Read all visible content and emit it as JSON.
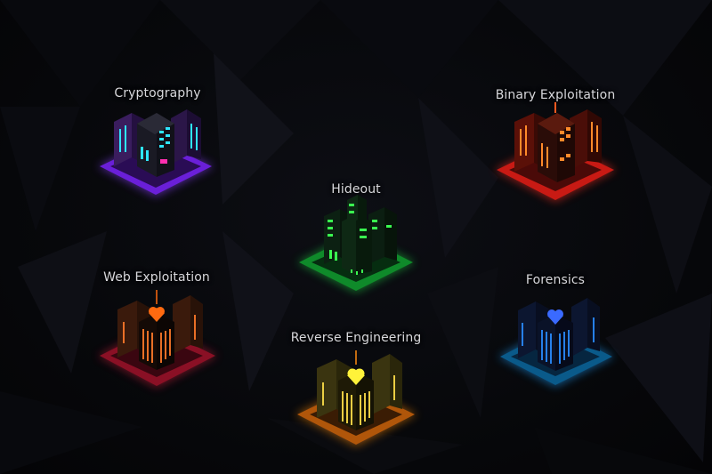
{
  "map": {
    "districts": [
      {
        "id": "cryptography",
        "label": "Cryptography",
        "base_color": "#6a1fd8",
        "glow_color": "#8a3cff",
        "window_color": "#2ee6ff",
        "accent_color": "#ff2fb0",
        "icon": "cryptography-building-icon"
      },
      {
        "id": "binary-exploitation",
        "label": "Binary Exploitation",
        "base_color": "#c81a14",
        "glow_color": "#ff2a1a",
        "window_color": "#ff8a2a",
        "accent_color": "#ff5a20",
        "icon": "binary-exploitation-building-icon"
      },
      {
        "id": "hideout",
        "label": "Hideout",
        "base_color": "#0f8a2a",
        "glow_color": "#1fd040",
        "window_color": "#3aff50",
        "accent_color": "#2cff44",
        "icon": "hideout-building-icon"
      },
      {
        "id": "web-exploitation",
        "label": "Web Exploitation",
        "base_color": "#8a1025",
        "glow_color": "#d11a3a",
        "window_color": "#ff7a2a",
        "accent_color": "#ff6a10",
        "icon": "web-exploitation-building-icon"
      },
      {
        "id": "forensics",
        "label": "Forensics",
        "base_color": "#0a5a8a",
        "glow_color": "#1aa0ff",
        "window_color": "#2a8cff",
        "accent_color": "#3a6aff",
        "icon": "forensics-building-icon"
      },
      {
        "id": "reverse-engineering",
        "label": "Reverse Engineering",
        "base_color": "#b0560a",
        "glow_color": "#ff8a10",
        "window_color": "#ffe04a",
        "accent_color": "#fff23a",
        "icon": "reverse-engineering-building-icon"
      }
    ]
  }
}
